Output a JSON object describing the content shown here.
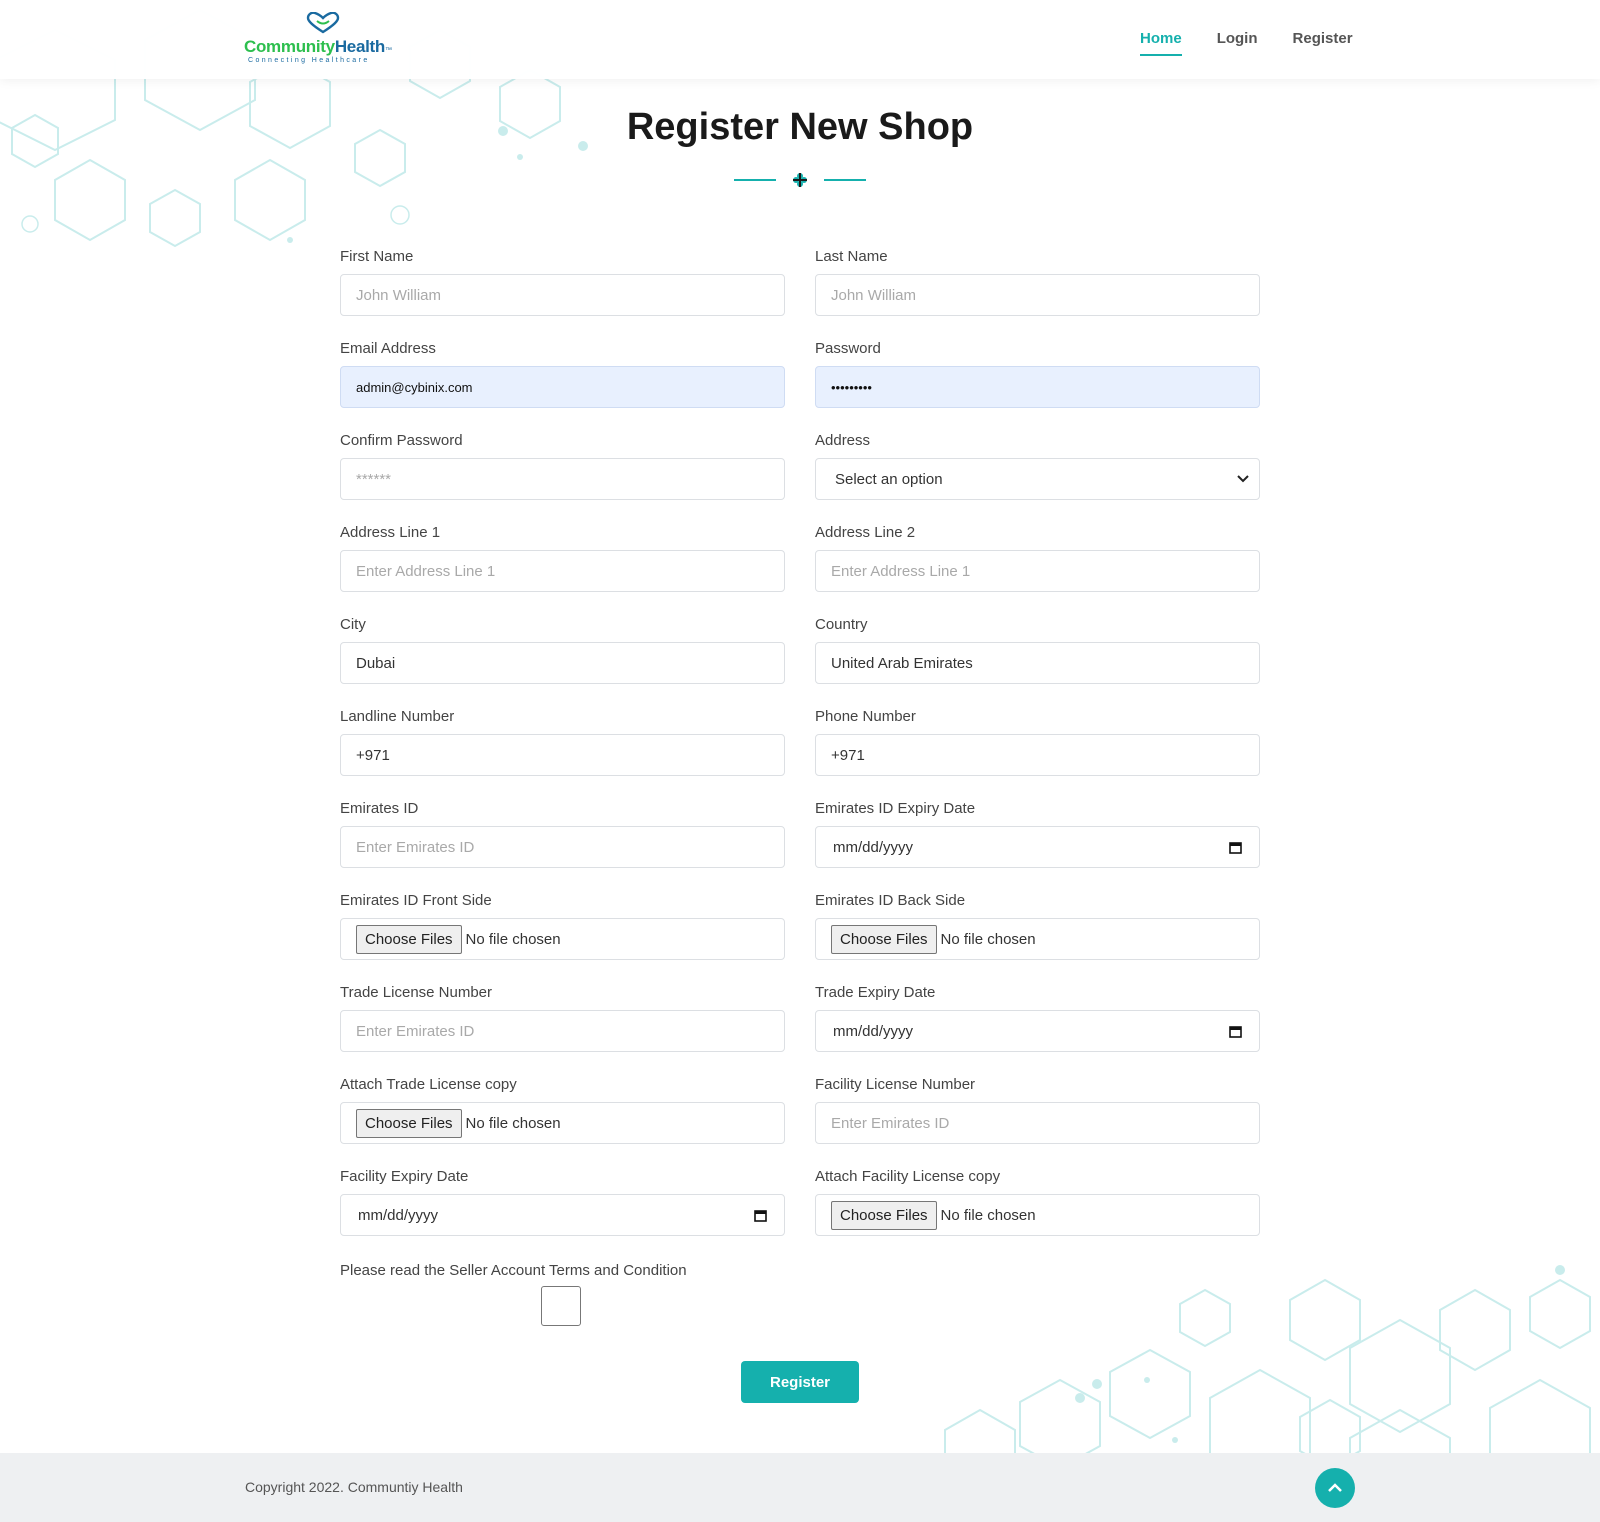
{
  "header": {
    "logo": {
      "brand_part1": "Community",
      "brand_part2": "Health",
      "trademark": "™",
      "tagline": "Connecting Healthcare"
    },
    "nav": [
      {
        "label": "Home",
        "active": true
      },
      {
        "label": "Login",
        "active": false
      },
      {
        "label": "Register",
        "active": false
      }
    ]
  },
  "page": {
    "title": "Register New Shop",
    "divider_icon": "medical-leaf-icon"
  },
  "form": {
    "first_name": {
      "label": "First Name",
      "placeholder": "John William"
    },
    "last_name": {
      "label": "Last Name",
      "placeholder": "John William"
    },
    "email": {
      "label": "Email Address",
      "value": "admin@cybinix.com"
    },
    "password": {
      "label": "Password",
      "value": "•••••••••"
    },
    "confirm_password": {
      "label": "Confirm Password",
      "placeholder": "******"
    },
    "address": {
      "label": "Address",
      "selected": "Select an option"
    },
    "address_line1": {
      "label": "Address Line 1",
      "placeholder": "Enter Address Line 1"
    },
    "address_line2": {
      "label": "Address Line 2",
      "placeholder": "Enter Address Line 1"
    },
    "city": {
      "label": "City",
      "value": "Dubai"
    },
    "country": {
      "label": "Country",
      "value": "United Arab Emirates"
    },
    "landline": {
      "label": "Landline Number",
      "value": "+971"
    },
    "phone": {
      "label": "Phone Number",
      "value": "+971"
    },
    "emirates_id": {
      "label": "Emirates ID",
      "placeholder": "Enter Emirates ID"
    },
    "emirates_id_expiry": {
      "label": "Emirates ID Expiry Date",
      "value": "mm/dd/yyyy"
    },
    "emirates_id_front": {
      "label": "Emirates ID Front Side",
      "button": "Choose Files",
      "status": "No file chosen"
    },
    "emirates_id_back": {
      "label": "Emirates ID Back Side",
      "button": "Choose Files",
      "status": "No file chosen"
    },
    "trade_license_number": {
      "label": "Trade License Number",
      "placeholder": "Enter Emirates ID"
    },
    "trade_expiry": {
      "label": "Trade Expiry Date",
      "value": "mm/dd/yyyy"
    },
    "trade_license_copy": {
      "label": "Attach Trade License copy",
      "button": "Choose Files",
      "status": "No file chosen"
    },
    "facility_license_number": {
      "label": "Facility License Number",
      "placeholder": "Enter Emirates ID"
    },
    "facility_expiry": {
      "label": "Facility Expiry Date",
      "value": "mm/dd/yyyy"
    },
    "facility_license_copy": {
      "label": "Attach Facility License copy",
      "button": "Choose Files",
      "status": "No file chosen"
    },
    "terms_text": "Please read the Seller Account Terms and Condition",
    "submit": "Register"
  },
  "footer": {
    "copyright": "Copyright 2022. Communtiy Health",
    "scroll_top_icon": "chevron-up-icon"
  },
  "colors": {
    "accent": "#15b0ad",
    "brand_green": "#2dbf4e",
    "brand_blue": "#1a6aa0",
    "autofill": "#e8f0fe"
  }
}
